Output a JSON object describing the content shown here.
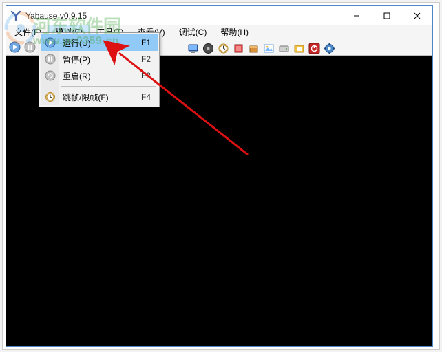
{
  "window": {
    "title": "Yabause v0.9.15"
  },
  "menubar": {
    "file": "文件(F)",
    "emulation": "模拟(E)",
    "tools": "工具(T)",
    "view": "查看(V)",
    "debug": "调试(C)",
    "help": "帮助(H)"
  },
  "dropdown": {
    "run": {
      "label": "运行(U)",
      "shortcut": "F1"
    },
    "pause": {
      "label": "暂停(P)",
      "shortcut": "F2"
    },
    "restart": {
      "label": "重启(R)",
      "shortcut": "F3"
    },
    "frameskip": {
      "label": "跳帧/限帧(F)",
      "shortcut": "F4"
    }
  },
  "toolbar_icons": {
    "run": "run-icon",
    "pause": "pause-icon",
    "restart": "restart-icon",
    "monitor": "monitor-icon",
    "disc": "disc-icon",
    "clock": "clock-icon",
    "chip": "chip-icon",
    "box": "box-icon",
    "image": "image-icon",
    "hdd": "hdd-icon",
    "snapshot": "snapshot-icon",
    "power": "power-icon",
    "settings": "settings-icon"
  },
  "watermark": {
    "line1": "河东软件园",
    "line2": "www.pc0359.cn"
  }
}
